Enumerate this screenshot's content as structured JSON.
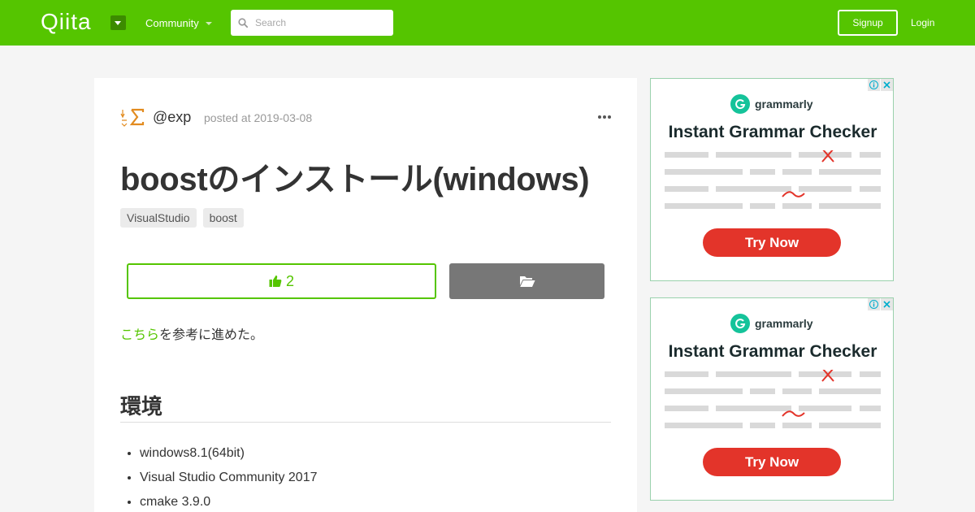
{
  "header": {
    "logo_text": "Qiita",
    "community_label": "Community",
    "search_placeholder": "Search",
    "signup_label": "Signup",
    "login_label": "Login"
  },
  "article": {
    "author": "@exp",
    "posted_at": "posted at 2019-03-08",
    "title": "boostのインストール(windows)",
    "tags": [
      "VisualStudio",
      "boost"
    ],
    "like_count": "2",
    "intro_link": "こちら",
    "intro_rest": "を参考に進めた。",
    "section_heading": "環境",
    "environment": [
      "windows8.1(64bit)",
      "Visual Studio Community 2017",
      "cmake 3.9.0"
    ]
  },
  "ads": [
    {
      "brand": "grammarly",
      "headline": "Instant Grammar Checker",
      "cta": "Try Now"
    },
    {
      "brand": "grammarly",
      "headline": "Instant Grammar Checker",
      "cta": "Try Now"
    }
  ],
  "colors": {
    "brand_green": "#55c500",
    "ad_red": "#e3342a",
    "grammarly_green": "#15c39a"
  }
}
